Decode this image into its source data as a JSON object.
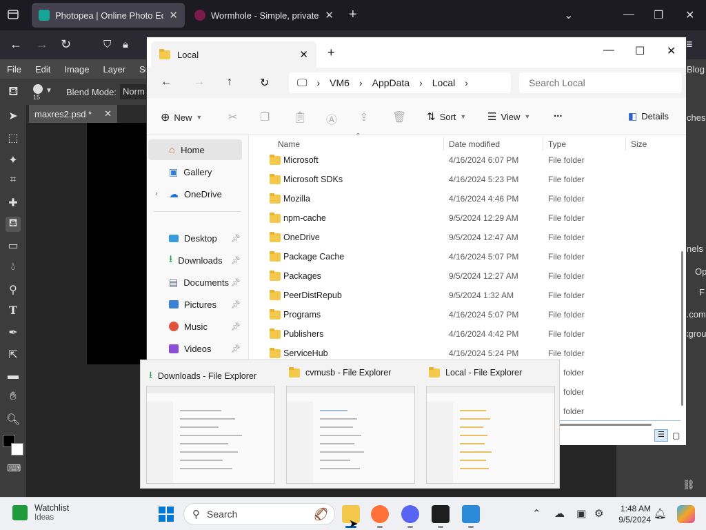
{
  "browser": {
    "tabs": [
      {
        "title": "Photopea | Online Photo Editor",
        "active": true
      },
      {
        "title": "Wormhole - Simple, private file",
        "active": false
      }
    ]
  },
  "photopea": {
    "menu": [
      "File",
      "Edit",
      "Image",
      "Layer",
      "Sel"
    ],
    "blend_mode_label": "Blend Mode:",
    "blend_mode_value": "Norm",
    "brush_size": "15",
    "document_tab": "maxres2.psd *",
    "right_panel": {
      "top_label": "ches",
      "mid_label": "nels",
      "op_label": "Op",
      "f_label": "F",
      "com_label": "r.com",
      "kgrou_label": "kgrou",
      "blog_label": "Blog"
    }
  },
  "explorer": {
    "tab_title": "Local",
    "breadcrumb": [
      "VM6",
      "AppData",
      "Local"
    ],
    "search_placeholder": "Search Local",
    "commands": {
      "new": "New",
      "sort": "Sort",
      "view": "View",
      "more": "...",
      "details": "Details"
    },
    "nav": [
      {
        "label": "Home",
        "icon": "home-icon",
        "selected": true
      },
      {
        "label": "Gallery",
        "icon": "gallery-icon"
      },
      {
        "label": "OneDrive",
        "icon": "cloud-icon"
      },
      {
        "label": "Desktop",
        "icon": "desktop-icon",
        "pinned": true
      },
      {
        "label": "Downloads",
        "icon": "download-icon",
        "pinned": true
      },
      {
        "label": "Documents",
        "icon": "document-icon",
        "pinned": true
      },
      {
        "label": "Pictures",
        "icon": "pictures-icon",
        "pinned": true
      },
      {
        "label": "Music",
        "icon": "music-icon",
        "pinned": true
      },
      {
        "label": "Videos",
        "icon": "videos-icon",
        "pinned": true
      }
    ],
    "columns": [
      "Name",
      "Date modified",
      "Type",
      "Size"
    ],
    "rows": [
      {
        "name": "Microsoft",
        "date": "4/16/2024 6:07 PM",
        "type": "File folder"
      },
      {
        "name": "Microsoft SDKs",
        "date": "4/16/2024 5:23 PM",
        "type": "File folder"
      },
      {
        "name": "Mozilla",
        "date": "4/16/2024 4:46 PM",
        "type": "File folder"
      },
      {
        "name": "npm-cache",
        "date": "9/5/2024 12:29 AM",
        "type": "File folder"
      },
      {
        "name": "OneDrive",
        "date": "9/5/2024 12:47 AM",
        "type": "File folder"
      },
      {
        "name": "Package Cache",
        "date": "4/16/2024 5:07 PM",
        "type": "File folder"
      },
      {
        "name": "Packages",
        "date": "9/5/2024 12:27 AM",
        "type": "File folder"
      },
      {
        "name": "PeerDistRepub",
        "date": "9/5/2024 1:32 AM",
        "type": "File folder"
      },
      {
        "name": "Programs",
        "date": "4/16/2024 5:07 PM",
        "type": "File folder"
      },
      {
        "name": "Publishers",
        "date": "4/16/2024 4:42 PM",
        "type": "File folder"
      },
      {
        "name": "ServiceHub",
        "date": "4/16/2024 5:24 PM",
        "type": "File folder"
      }
    ],
    "partial_rows": [
      "folder",
      "folder",
      "folder",
      "folder"
    ]
  },
  "thumbnails": [
    {
      "title": "Downloads - File Explorer",
      "icon": "download-icon"
    },
    {
      "title": "cvmusb - File Explorer",
      "icon": "folder-icon"
    },
    {
      "title": "Local - File Explorer",
      "icon": "folder-icon"
    }
  ],
  "taskbar": {
    "widget_title": "Watchlist",
    "widget_sub": "Ideas",
    "search_placeholder": "Search",
    "time": "1:48 AM",
    "date": "9/5/2024"
  }
}
